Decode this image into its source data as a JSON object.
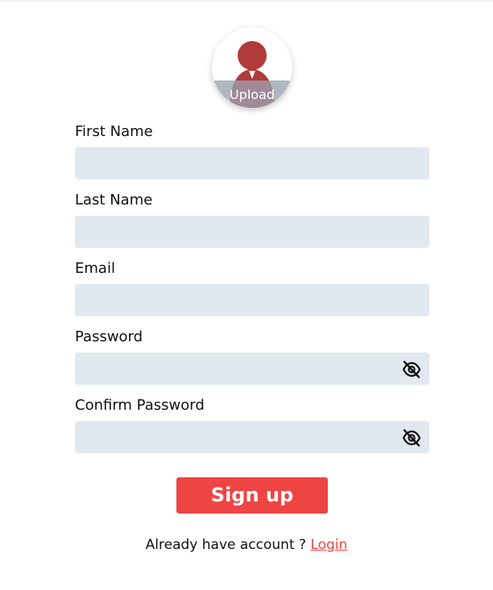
{
  "avatar": {
    "upload_label": "Upload",
    "icon": "user-avatar-icon",
    "icon_color": "#b13a3a"
  },
  "form": {
    "first_name": {
      "label": "First Name",
      "value": "",
      "placeholder": ""
    },
    "last_name": {
      "label": "Last Name",
      "value": "",
      "placeholder": ""
    },
    "email": {
      "label": "Email",
      "value": "",
      "placeholder": ""
    },
    "password": {
      "label": "Password",
      "value": "",
      "placeholder": "",
      "toggle_icon": "eye-slash-icon"
    },
    "confirm_password": {
      "label": "Confirm Password",
      "value": "",
      "placeholder": "",
      "toggle_icon": "eye-slash-icon"
    }
  },
  "submit": {
    "label": "Sign up"
  },
  "footer": {
    "prompt": "Already have account ? ",
    "link_label": "Login"
  },
  "colors": {
    "input_bg": "#e2e8f0",
    "accent": "#ef4444"
  }
}
